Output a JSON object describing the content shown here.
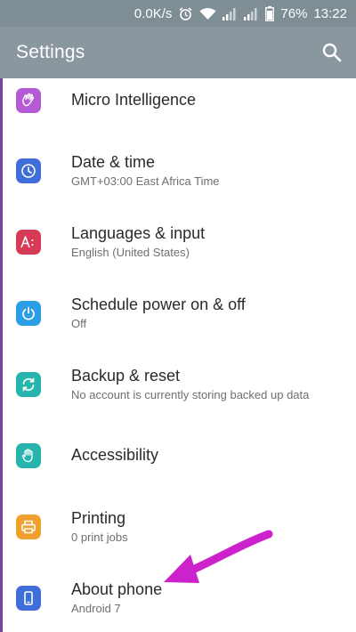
{
  "status_bar": {
    "speed": "0.0K/s",
    "battery_percent": "76%",
    "time": "13:22",
    "icons": [
      "alarm-icon",
      "wifi-icon",
      "signal-icon",
      "signal-icon",
      "battery-icon"
    ]
  },
  "app_bar": {
    "title": "Settings",
    "search_icon": "search-icon"
  },
  "items": [
    {
      "label": "Micro Intelligence",
      "subtitle": "",
      "icon": "hand-gesture-icon",
      "color": "#b35ad4"
    },
    {
      "label": "Date & time",
      "subtitle": "GMT+03:00 East Africa Time",
      "icon": "clock-icon",
      "color": "#3e6fd8"
    },
    {
      "label": "Languages & input",
      "subtitle": "English (United States)",
      "icon": "language-icon",
      "color": "#d63a57"
    },
    {
      "label": "Schedule power on & off",
      "subtitle": "Off",
      "icon": "power-icon",
      "color": "#2b9ee8"
    },
    {
      "label": "Backup & reset",
      "subtitle": "No account is currently storing backed up data",
      "icon": "backup-icon",
      "color": "#25b5ad"
    },
    {
      "label": "Accessibility",
      "subtitle": "",
      "icon": "accessibility-hand-icon",
      "color": "#25b5ad"
    },
    {
      "label": "Printing",
      "subtitle": "0 print jobs",
      "icon": "printer-icon",
      "color": "#f0a12c"
    },
    {
      "label": "About phone",
      "subtitle": "Android 7",
      "icon": "phone-icon",
      "color": "#3e6fd8"
    }
  ],
  "annotation": {
    "arrow_color": "#cc22cc"
  }
}
